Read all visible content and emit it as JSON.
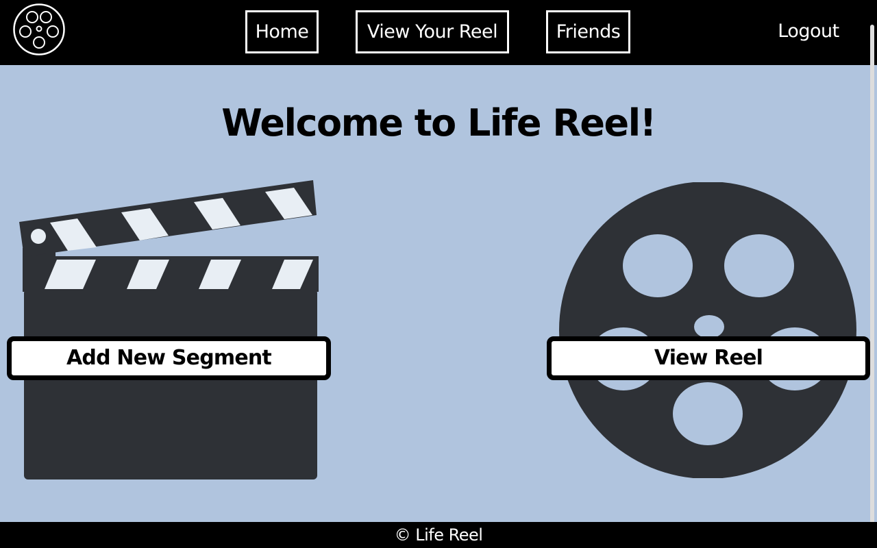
{
  "header": {
    "logo_icon": "film-reel-icon",
    "nav": {
      "home": "Home",
      "view_your_reel": "View Your Reel",
      "friends": "Friends"
    },
    "logout": "Logout"
  },
  "main": {
    "title": "Welcome to Life Reel!",
    "add_segment_label": "Add New Segment",
    "view_reel_label": "View Reel",
    "clapperboard_icon": "clapperboard-icon",
    "reel_icon": "film-reel-icon"
  },
  "footer": {
    "text": "© Life Reel"
  },
  "colors": {
    "background": "#b0c4de",
    "header_bg": "#000000",
    "illustration_dark": "#2e3136",
    "stripe_light": "#e8eef4"
  }
}
